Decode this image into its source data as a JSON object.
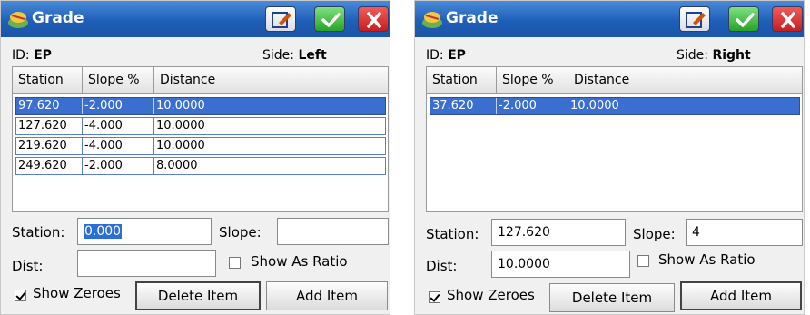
{
  "windows": [
    {
      "title": "Grade",
      "id_label": "ID:",
      "id_value": "EP",
      "side_label": "Side:",
      "side_value": "Left",
      "columns": [
        "Station",
        "Slope %",
        "Distance"
      ],
      "rows": [
        {
          "station": "97.620",
          "slope": "-2.000",
          "distance": "10.0000",
          "selected": true
        },
        {
          "station": "127.620",
          "slope": "-4.000",
          "distance": "10.0000",
          "selected": false
        },
        {
          "station": "219.620",
          "slope": "-4.000",
          "distance": "10.0000",
          "selected": false
        },
        {
          "station": "249.620",
          "slope": "-2.000",
          "distance": "8.0000",
          "selected": false
        }
      ],
      "station_label": "Station:",
      "station_value": "0.000",
      "slope_label": "Slope:",
      "slope_value": "",
      "dist_label": "Dist:",
      "dist_value": "",
      "show_as_ratio_label": "Show As Ratio",
      "show_as_ratio_checked": false,
      "show_zeroes_label": "Show Zeroes",
      "show_zeroes_checked": true,
      "delete_label": "Delete Item",
      "add_label": "Add Item"
    },
    {
      "title": "Grade",
      "id_label": "ID:",
      "id_value": "EP",
      "side_label": "Side:",
      "side_value": "Right",
      "columns": [
        "Station",
        "Slope %",
        "Distance"
      ],
      "rows": [
        {
          "station": "37.620",
          "slope": "-2.000",
          "distance": "10.0000",
          "selected": true
        }
      ],
      "station_label": "Station:",
      "station_value": "127.620",
      "slope_label": "Slope:",
      "slope_value": "4",
      "dist_label": "Dist:",
      "dist_value": "10.0000",
      "show_as_ratio_label": "Show As Ratio",
      "show_as_ratio_checked": false,
      "show_zeroes_label": "Show Zeroes",
      "show_zeroes_checked": true,
      "delete_label": "Delete Item",
      "add_label": "Add Item"
    }
  ],
  "icons": {
    "app": "survey-app-icon",
    "edit": "edit-icon",
    "ok": "checkmark-icon",
    "cancel": "close-icon"
  },
  "colors": {
    "titlebar": "#1f5fb8",
    "selection": "#3a6fd0",
    "ok_button": "#27a327",
    "cancel_button": "#c81e1e"
  }
}
